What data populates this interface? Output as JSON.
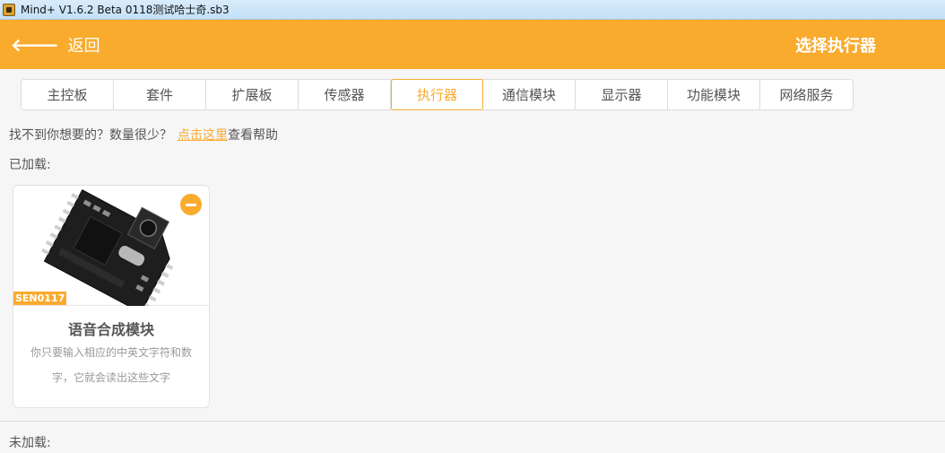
{
  "window": {
    "title": "Mind+ V1.6.2 Beta   0118测试哈士奇.sb3"
  },
  "header": {
    "back_arrow": "🡐",
    "back_label": "返回",
    "title": "选择执行器"
  },
  "tabs": [
    {
      "label": "主控板",
      "active": false
    },
    {
      "label": "套件",
      "active": false
    },
    {
      "label": "扩展板",
      "active": false
    },
    {
      "label": "传感器",
      "active": false
    },
    {
      "label": "执行器",
      "active": true
    },
    {
      "label": "通信模块",
      "active": false
    },
    {
      "label": "显示器",
      "active": false
    },
    {
      "label": "功能模块",
      "active": false
    },
    {
      "label": "网络服务",
      "active": false
    }
  ],
  "help": {
    "prefix": "找不到你想要的？数量很少？",
    "link": "点击这里",
    "suffix": "查看帮助"
  },
  "sections": {
    "loaded": "已加载:",
    "unloaded": "未加载:"
  },
  "loaded_items": [
    {
      "sku": "SEN0117",
      "title": "语音合成模块",
      "description": "你只要输入相应的中英文字符和数字，它就会读出这些文字",
      "icon": "speech-synthesis-module-image"
    }
  ],
  "colors": {
    "accent": "#f9ab2d",
    "text": "#555555",
    "muted": "#999999",
    "background": "#f6f6f6"
  }
}
